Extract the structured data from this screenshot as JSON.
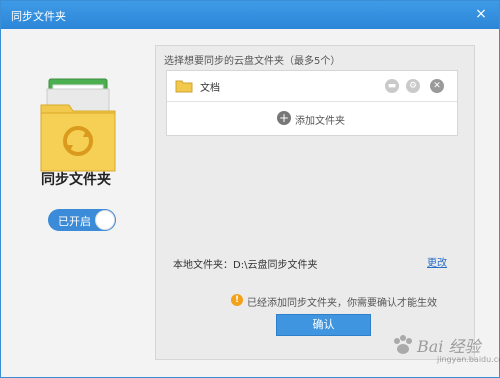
{
  "window": {
    "title": "同步文件夹",
    "close_icon": "×"
  },
  "left": {
    "folder_icon": "sync-folder-icon",
    "heading": "同步文件夹",
    "toggle_label": "已开启"
  },
  "panel": {
    "hint": "选择想要同步的云盘文件夹（最多5个）",
    "items": [
      {
        "name": "文档",
        "icon": "folder-icon"
      }
    ],
    "add_label": "添加文件夹",
    "local_folder": "本地文件夹：D:\\云盘同步文件夹",
    "change_link": "更改",
    "notice": "已经添加同步文件夹，你需要确认才能生效",
    "confirm_label": "确认"
  },
  "colors": {
    "titlebar": "#2b86d8",
    "accent": "#3f95e0",
    "warning": "#f3a11b",
    "folder": "#f2c94c"
  },
  "watermark": {
    "text": "Bai 经验",
    "sub": "jingyan.baidu.com"
  }
}
